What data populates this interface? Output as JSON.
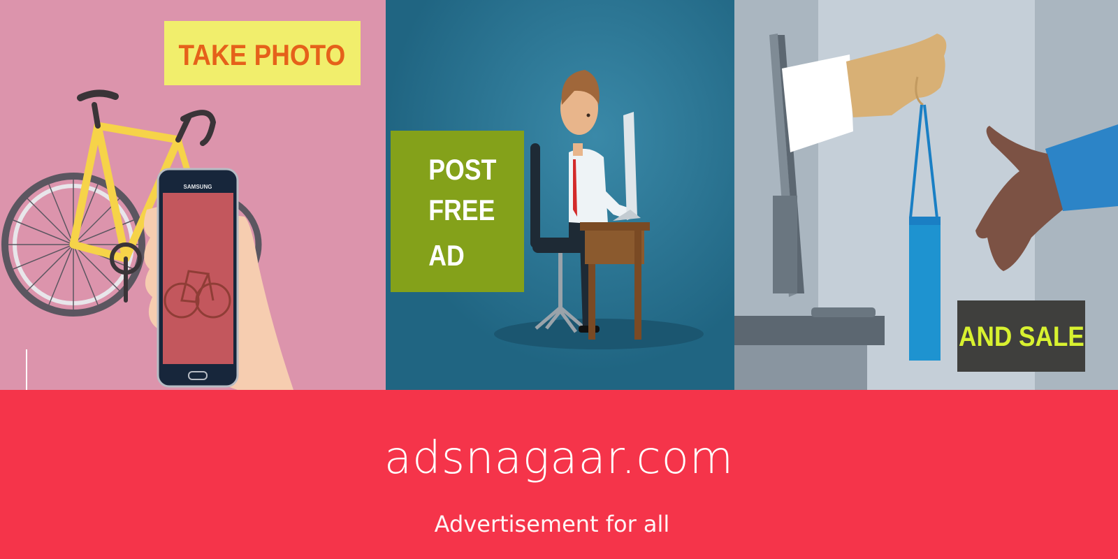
{
  "steps": [
    {
      "label": "TAKE PHOTO",
      "box_color": "#f1ee6c",
      "text_color": "#e5611a"
    },
    {
      "label_lines": [
        "POST",
        "FREE",
        "AD"
      ],
      "box_color": "#84a11a",
      "text_color": "#ffffff"
    },
    {
      "label": "AND SALE",
      "box_color": "#3f3f3d",
      "text_color": "#d8f130"
    }
  ],
  "phone_brand": "SAMSUNG",
  "site": {
    "name": "adsnagaar.com",
    "tagline": "Advertisement for all"
  },
  "colors": {
    "panel1_bg": "#dc94ac",
    "panel2_bg": "#206582",
    "panel3_bg": "#c5cfd8",
    "footer_bg": "#f5344a"
  },
  "icons": [
    "bicycle-illustration",
    "smartphone-illustration",
    "office-worker-illustration",
    "online-shopping-handshake-illustration"
  ]
}
